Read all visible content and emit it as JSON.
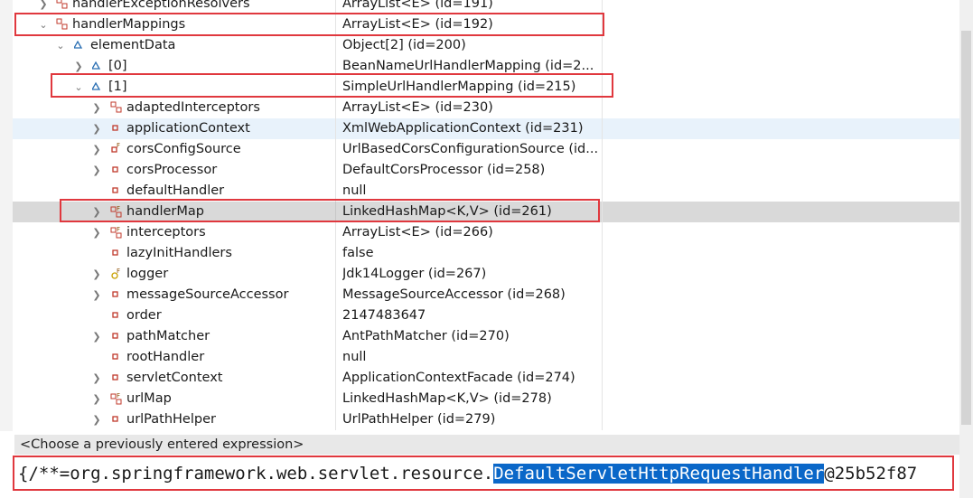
{
  "rows": [
    {
      "name": "handlerExceptionResolvers",
      "value": "ArrayList<E>  (id=191)"
    },
    {
      "name": "handlerMappings",
      "value": "ArrayList<E>  (id=192)"
    },
    {
      "name": "elementData",
      "value": "Object[2]  (id=200)"
    },
    {
      "name": "[0]",
      "value": "BeanNameUrlHandlerMapping  (id=2..."
    },
    {
      "name": "[1]",
      "value": "SimpleUrlHandlerMapping  (id=215)"
    },
    {
      "name": "adaptedInterceptors",
      "value": "ArrayList<E>  (id=230)"
    },
    {
      "name": "applicationContext",
      "value": "XmlWebApplicationContext  (id=231)"
    },
    {
      "name": "corsConfigSource",
      "value": "UrlBasedCorsConfigurationSource  (id..."
    },
    {
      "name": "corsProcessor",
      "value": "DefaultCorsProcessor  (id=258)"
    },
    {
      "name": "defaultHandler",
      "value": "null"
    },
    {
      "name": "handlerMap",
      "value": "LinkedHashMap<K,V>  (id=261)"
    },
    {
      "name": "interceptors",
      "value": "ArrayList<E>  (id=266)"
    },
    {
      "name": "lazyInitHandlers",
      "value": "false"
    },
    {
      "name": "logger",
      "value": "Jdk14Logger  (id=267)"
    },
    {
      "name": "messageSourceAccessor",
      "value": "MessageSourceAccessor  (id=268)"
    },
    {
      "name": "order",
      "value": "2147483647"
    },
    {
      "name": "pathMatcher",
      "value": "AntPathMatcher  (id=270)"
    },
    {
      "name": "rootHandler",
      "value": "null"
    },
    {
      "name": "servletContext",
      "value": "ApplicationContextFacade  (id=274)"
    },
    {
      "name": "urlMap",
      "value": "LinkedHashMap<K,V>  (id=278)"
    },
    {
      "name": "urlPathHelper",
      "value": "UrlPathHelper  (id=279)"
    }
  ],
  "history_placeholder": "<Choose a previously entered expression>",
  "expression": {
    "prefix": "{/**=org.springframework.web.servlet.resource.",
    "highlight": "DefaultServletHttpRequestHandler",
    "suffix": "@25b52f87"
  },
  "colors": {
    "annotation_box": "#e0383e",
    "selection_highlight": "#0a67c8"
  }
}
